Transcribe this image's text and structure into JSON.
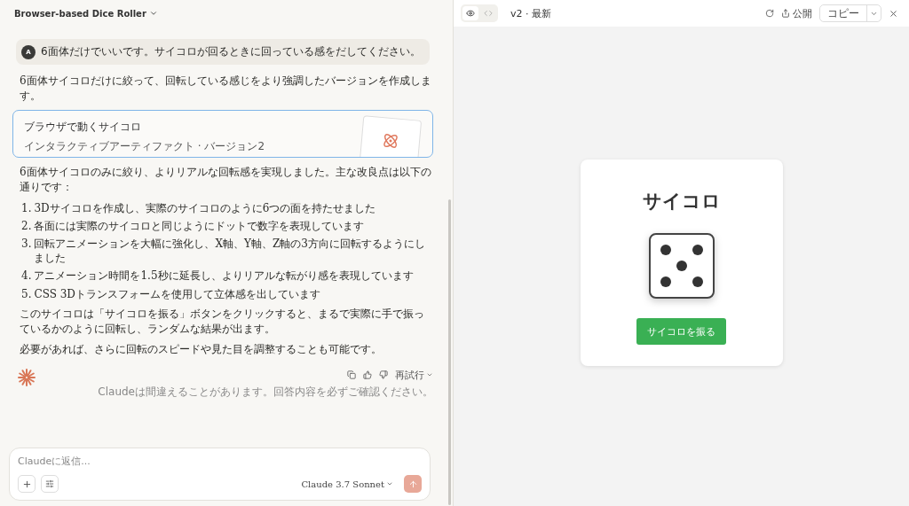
{
  "chat": {
    "title": "Browser-based Dice Roller",
    "user_message": {
      "avatar": "A",
      "text": "6面体だけでいいです。サイコロが回るときに回っている感をだしてください。"
    },
    "intro": "6面体サイコロだけに絞って、回転している感じをより強調したバージョンを作成します。",
    "artifact_card": {
      "title": "ブラウザで動くサイコロ",
      "subtitle": "インタラクティブアーティファクト · バージョン2"
    },
    "summary": "6面体サイコロのみに絞り、よりリアルな回転感を実現しました。主な改良点は以下の通りです：",
    "points": [
      {
        "number": "1.",
        "text": "3Dサイコロを作成し、実際のサイコロのように6つの面を持たせました"
      },
      {
        "number": "2.",
        "text": "各面には実際のサイコロと同じようにドットで数字を表現しています"
      },
      {
        "number": "3.",
        "text": "回転アニメーションを大幅に強化し、X軸、Y軸、Z軸の3方向に回転するようにしました"
      },
      {
        "number": "4.",
        "text": "アニメーション時間を1.5秒に延長し、よりリアルな転がり感を表現しています"
      },
      {
        "number": "5.",
        "text": "CSS 3Dトランスフォームを使用して立体感を出しています"
      }
    ],
    "paragraphs": [
      "このサイコロは「サイコロを振る」ボタンをクリックすると、まるで実際に手で振っているかのように回転し、ランダムな結果が出ます。",
      "必要があれば、さらに回転のスピードや見た目を調整することも可能です。"
    ],
    "retry": "再試行",
    "disclaimer": "Claudeは間違えることがあります。回答内容を必ずご確認ください。",
    "composer": {
      "placeholder": "Claudeに返信...",
      "model": "Claude 3.7 Sonnet"
    }
  },
  "preview": {
    "view_toggle": [
      {
        "kind": "preview",
        "selected": true
      },
      {
        "kind": "code",
        "selected": false
      }
    ],
    "version": "v2 · 最新",
    "publish": "公開",
    "copy": "コピー",
    "app": {
      "title": "サイコロ",
      "button": "サイコロを振る"
    }
  }
}
